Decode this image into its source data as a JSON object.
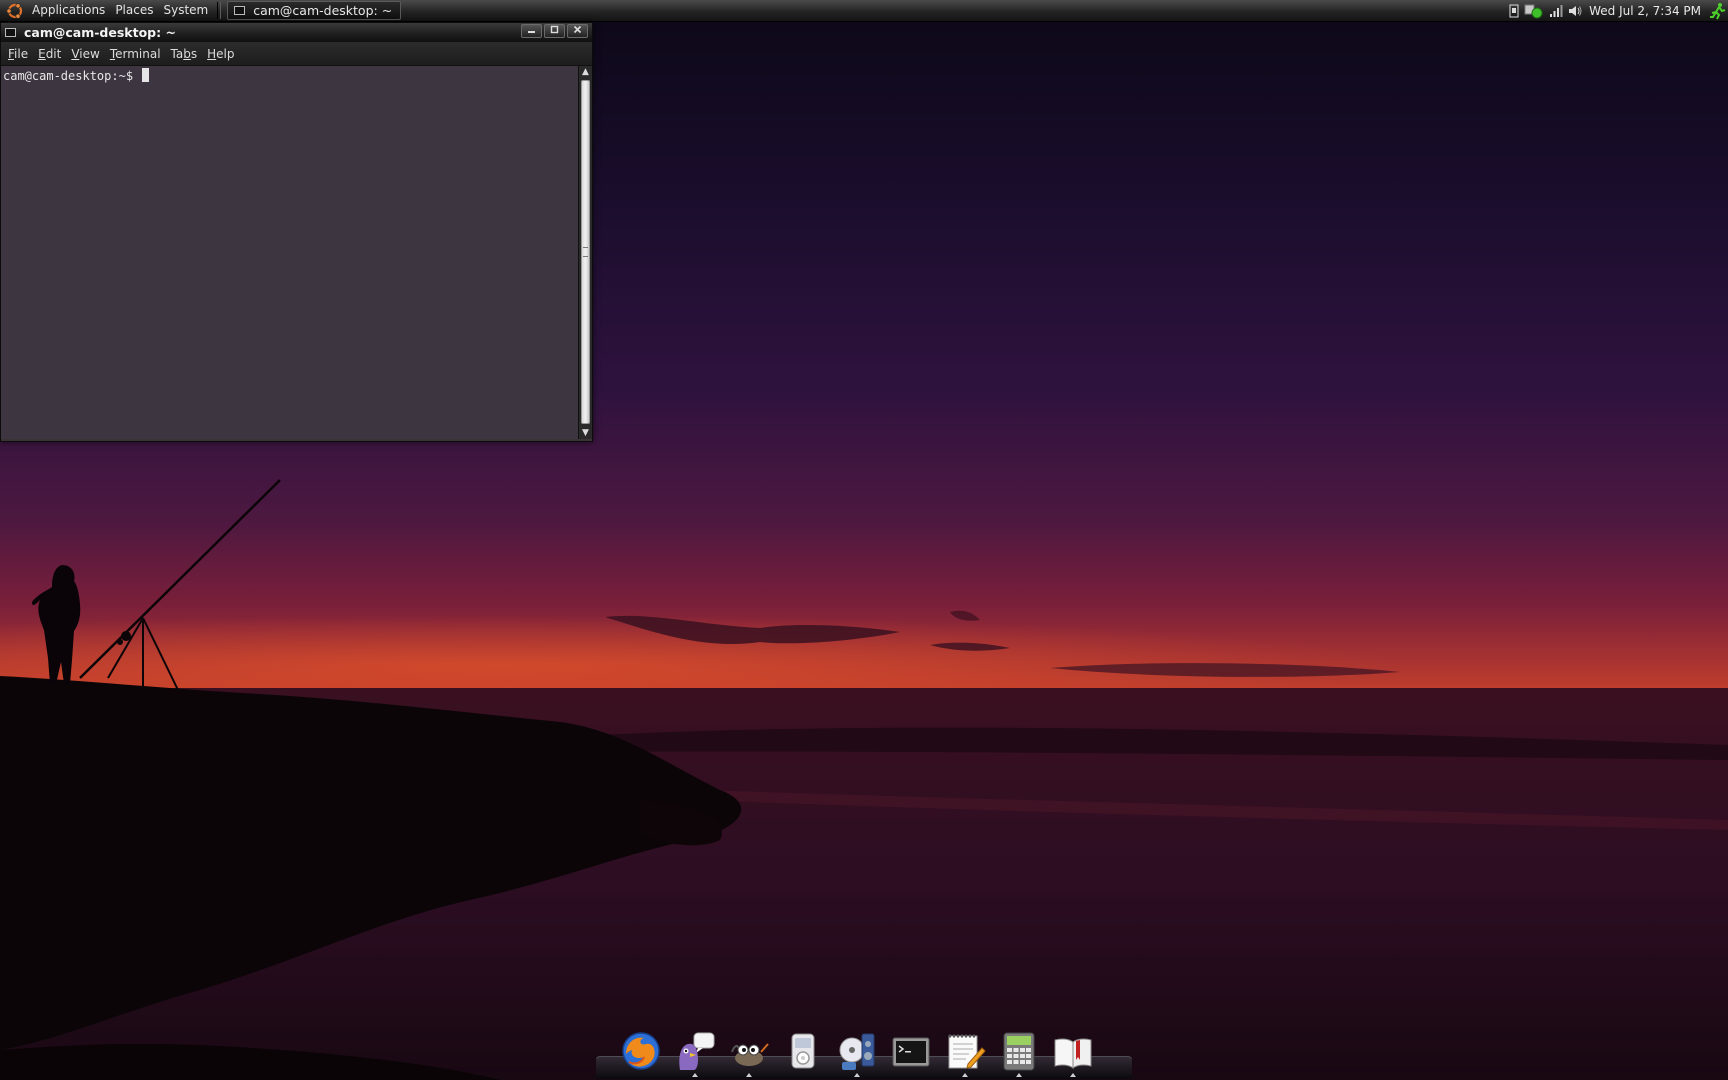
{
  "top_panel": {
    "menus": [
      "Applications",
      "Places",
      "System"
    ],
    "task_button": "cam@cam-desktop: ~",
    "clock": "Wed Jul  2,  7:34 PM"
  },
  "terminal": {
    "title": "cam@cam-desktop: ~",
    "menu": [
      {
        "mnemonic": "F",
        "rest": "ile"
      },
      {
        "mnemonic": "E",
        "rest": "dit"
      },
      {
        "mnemonic": "V",
        "rest": "iew"
      },
      {
        "mnemonic": "T",
        "rest": "erminal"
      },
      {
        "pre": "Ta",
        "mnemonic": "b",
        "rest": "s"
      },
      {
        "mnemonic": "H",
        "rest": "elp"
      }
    ],
    "prompt": "cam@cam-desktop:~$ "
  },
  "dock": {
    "items": [
      {
        "icon": "firefox-icon",
        "running": false
      },
      {
        "icon": "pidgin-icon",
        "running": true
      },
      {
        "icon": "gimp-icon",
        "running": true
      },
      {
        "icon": "music-player-icon",
        "running": false
      },
      {
        "icon": "sound-juicer-icon",
        "running": true
      },
      {
        "icon": "terminal-icon",
        "running": false
      },
      {
        "icon": "text-editor-icon",
        "running": true
      },
      {
        "icon": "calculator-icon",
        "running": true
      },
      {
        "icon": "dictionary-icon",
        "running": true
      }
    ]
  },
  "colors": {
    "panel": "#1e1e1e",
    "terminal_bg": "#3d3540",
    "sunset_orange": "#d94a24",
    "sky_purple": "#2e123e"
  }
}
